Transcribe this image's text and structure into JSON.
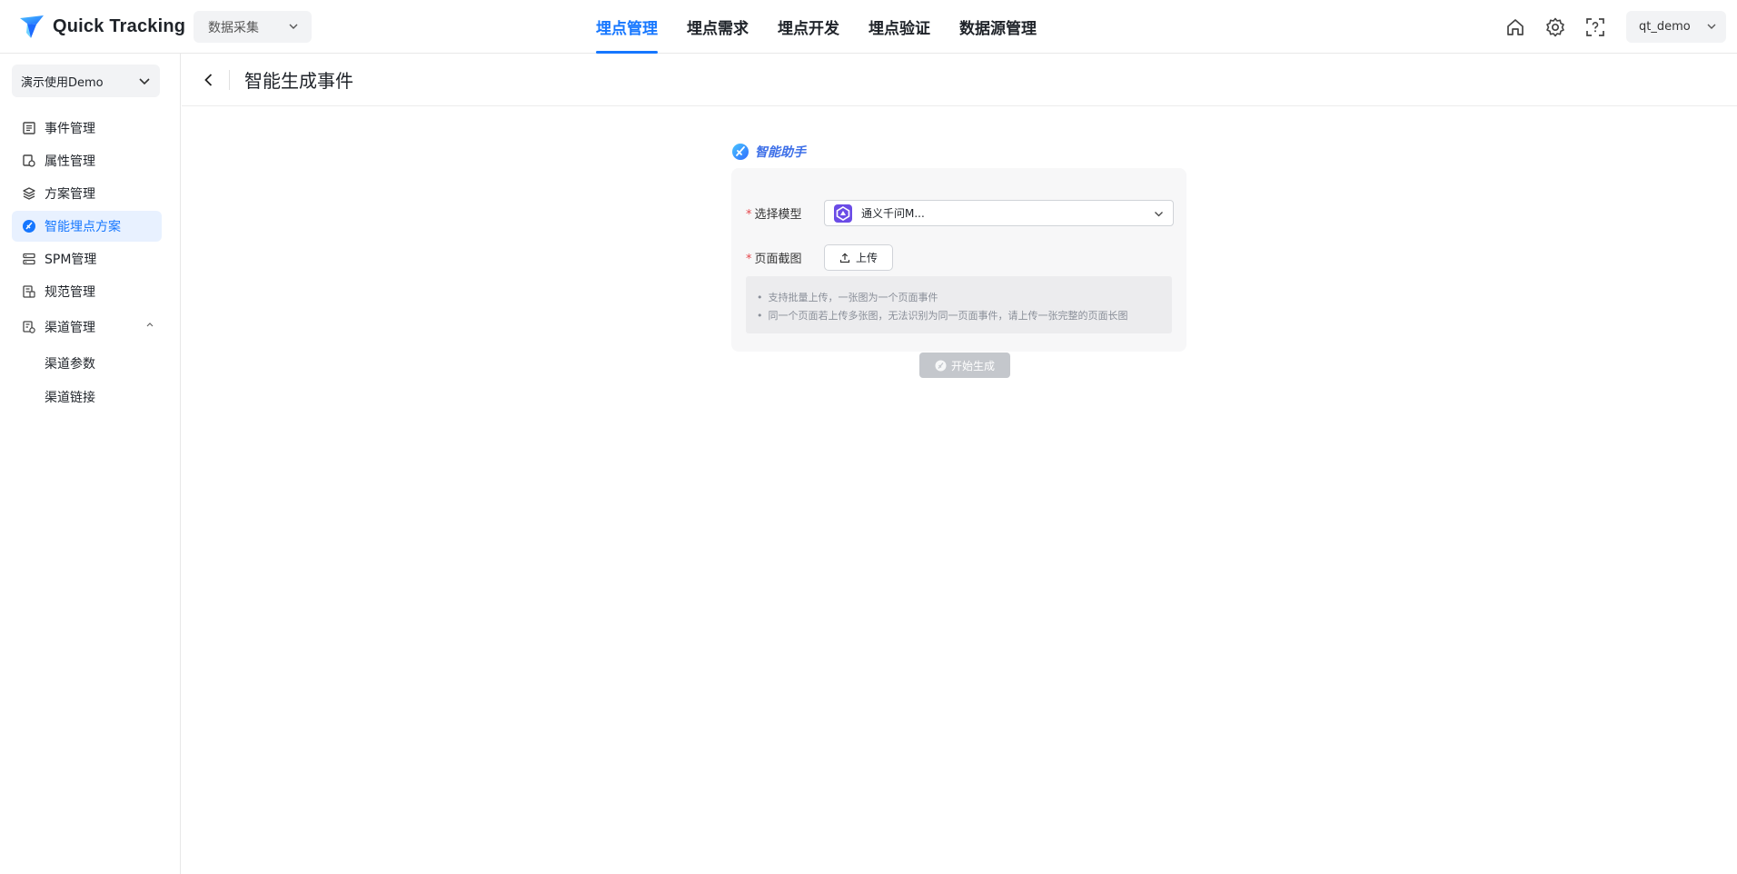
{
  "header": {
    "brand": "Quick Tracking",
    "module_select": "数据采集",
    "tabs": [
      {
        "label": "埋点管理",
        "active": true
      },
      {
        "label": "埋点需求",
        "active": false
      },
      {
        "label": "埋点开发",
        "active": false
      },
      {
        "label": "埋点验证",
        "active": false
      },
      {
        "label": "数据源管理",
        "active": false
      }
    ],
    "icons": [
      "home-icon",
      "settings-icon",
      "help-scan-icon"
    ],
    "user": "qt_demo"
  },
  "sidebar": {
    "project": "演示使用Demo",
    "items": [
      {
        "label": "事件管理",
        "icon": "event-list-icon",
        "active": false
      },
      {
        "label": "属性管理",
        "icon": "property-icon",
        "active": false
      },
      {
        "label": "方案管理",
        "icon": "layers-icon",
        "active": false
      },
      {
        "label": "智能埋点方案",
        "icon": "ai-icon",
        "active": true
      },
      {
        "label": "SPM管理",
        "icon": "spm-icon",
        "active": false
      },
      {
        "label": "规范管理",
        "icon": "rules-icon",
        "active": false
      }
    ],
    "group": {
      "label": "渠道管理",
      "icon": "channel-icon",
      "expanded": true
    },
    "sub_items": [
      {
        "label": "渠道参数"
      },
      {
        "label": "渠道链接"
      }
    ]
  },
  "main": {
    "title": "智能生成事件",
    "assistant_label": "智能助手",
    "form": {
      "model_label": "选择模型",
      "model_value": "通义千问M...",
      "screenshot_label": "页面截图",
      "upload_label": "上传",
      "tips": [
        "支持批量上传，一张图为一个页面事件",
        "同一个页面若上传多张图，无法识别为同一页面事件，请上传一张完整的页面长图"
      ],
      "generate_label": "开始生成"
    }
  },
  "colors": {
    "accent": "#1677ff",
    "active_bg": "#e8f1ff",
    "required": "#e5484d",
    "disabled_button": "#c4c7cc"
  }
}
